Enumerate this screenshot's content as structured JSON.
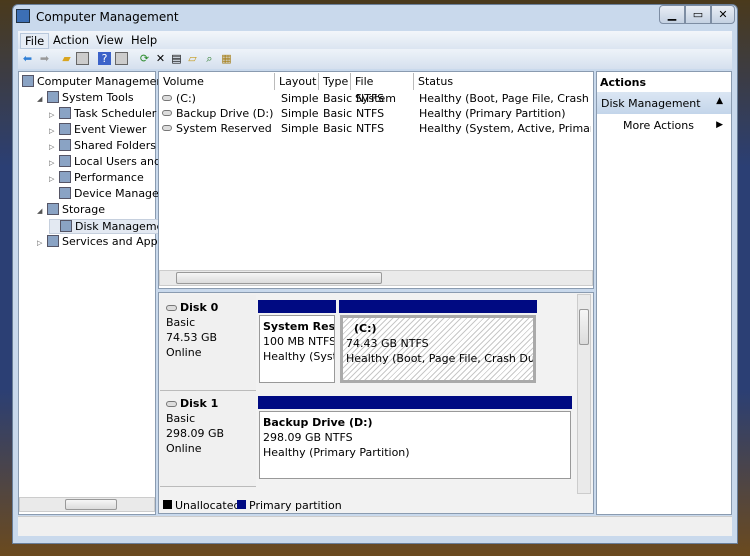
{
  "window": {
    "title": "Computer Management",
    "controls": [
      "minimize",
      "maximize",
      "close"
    ]
  },
  "menu": [
    "File",
    "Action",
    "View",
    "Help"
  ],
  "toolbar_icons": [
    "back-icon",
    "forward-icon",
    "up-folder-icon",
    "show-hide-tree-icon",
    "help-icon",
    "show-hide-action-icon",
    "refresh-icon",
    "delete-icon",
    "properties-icon",
    "open-icon",
    "search-icon",
    "settings-icon"
  ],
  "tree": [
    {
      "label": "Computer Management",
      "level": 0,
      "icon": "computer-management-icon"
    },
    {
      "label": "System Tools",
      "level": 1,
      "icon": "tools-icon",
      "expanded": true
    },
    {
      "label": "Task Scheduler",
      "level": 2,
      "icon": "clock-icon"
    },
    {
      "label": "Event Viewer",
      "level": 2,
      "icon": "event-viewer-icon"
    },
    {
      "label": "Shared Folders",
      "level": 2,
      "icon": "shared-folder-icon"
    },
    {
      "label": "Local Users and Gr",
      "level": 2,
      "icon": "users-icon"
    },
    {
      "label": "Performance",
      "level": 2,
      "icon": "performance-icon"
    },
    {
      "label": "Device Manager",
      "level": 2,
      "icon": "device-manager-icon"
    },
    {
      "label": "Storage",
      "level": 1,
      "icon": "storage-icon",
      "expanded": true
    },
    {
      "label": "Disk Management",
      "level": 2,
      "icon": "disk-icon",
      "selected": true
    },
    {
      "label": "Services and Applicat",
      "level": 1,
      "icon": "services-icon"
    }
  ],
  "volumes": {
    "columns": [
      "Volume",
      "Layout",
      "Type",
      "File System",
      "Status"
    ],
    "rows": [
      [
        "(C:)",
        "Simple",
        "Basic",
        "NTFS",
        "Healthy (Boot, Page File, Crash Dum"
      ],
      [
        "Backup Drive (D:)",
        "Simple",
        "Basic",
        "NTFS",
        "Healthy (Primary Partition)"
      ],
      [
        "System Reserved (S:)",
        "Simple",
        "Basic",
        "NTFS",
        "Healthy (System, Active, Primary Par"
      ]
    ]
  },
  "disks": [
    {
      "name": "Disk 0",
      "type": "Basic",
      "size": "74.53 GB",
      "status": "Online",
      "partitions": [
        {
          "name": "System Reser",
          "size": "100 MB NTFS",
          "status": "Healthy (Syster"
        },
        {
          "name": "(C:)",
          "size": "74.43 GB NTFS",
          "status": "Healthy (Boot, Page File, Crash Dump, F"
        }
      ]
    },
    {
      "name": "Disk 1",
      "type": "Basic",
      "size": "298.09 GB",
      "status": "Online",
      "partitions": [
        {
          "name": "Backup Drive  (D:)",
          "size": "298.09 GB NTFS",
          "status": "Healthy (Primary Partition)"
        }
      ]
    }
  ],
  "legend": [
    {
      "label": "Unallocated",
      "color": "#000000"
    },
    {
      "label": "Primary partition",
      "color": "#000a82"
    }
  ],
  "actions": {
    "header": "Actions",
    "section": "Disk Management",
    "items": [
      "More Actions"
    ]
  }
}
